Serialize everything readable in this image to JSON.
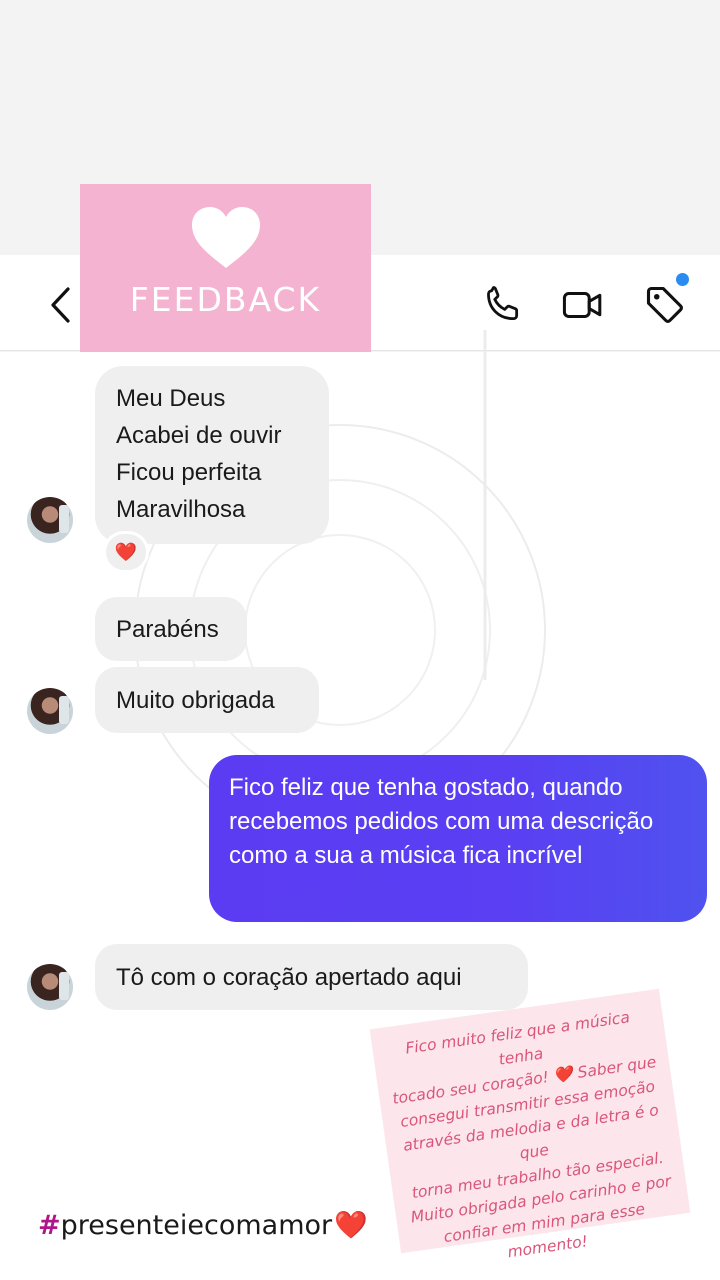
{
  "sticker": {
    "label": "FEEDBACK"
  },
  "header": {
    "icons": [
      "back-chevron-icon",
      "phone-icon",
      "video-camera-icon",
      "tag-icon"
    ],
    "notification_dot_color": "#2a8cf0"
  },
  "messages": {
    "incoming_1": {
      "lines": [
        "Meu Deus",
        "Acabei de ouvir",
        "Ficou perfeita",
        "Maravilhosa"
      ],
      "reaction": "❤️"
    },
    "incoming_2": {
      "text": "Parabéns"
    },
    "incoming_3": {
      "text": "Muito obrigada"
    },
    "outgoing_1": {
      "text": "Fico feliz que tenha gostado, quando recebemos pedidos com uma descrição como a sua a música fica incrível",
      "color": "#5b3cf2"
    },
    "incoming_4": {
      "text": "Tô com o coração apertado aqui"
    }
  },
  "note": {
    "lines": [
      "Fico muito feliz que a música tenha",
      "tocado seu coração! ❤️ Saber que",
      "consegui transmitir essa emoção",
      "através da melodia e da letra é o que",
      "torna meu trabalho tão especial.",
      "Muito obrigada pelo carinho e por",
      "confiar em mim para esse momento!"
    ],
    "color": "#d9567a"
  },
  "hashtag": {
    "hash": "#",
    "text": "presenteiecomamor",
    "emoji": "❤️"
  }
}
